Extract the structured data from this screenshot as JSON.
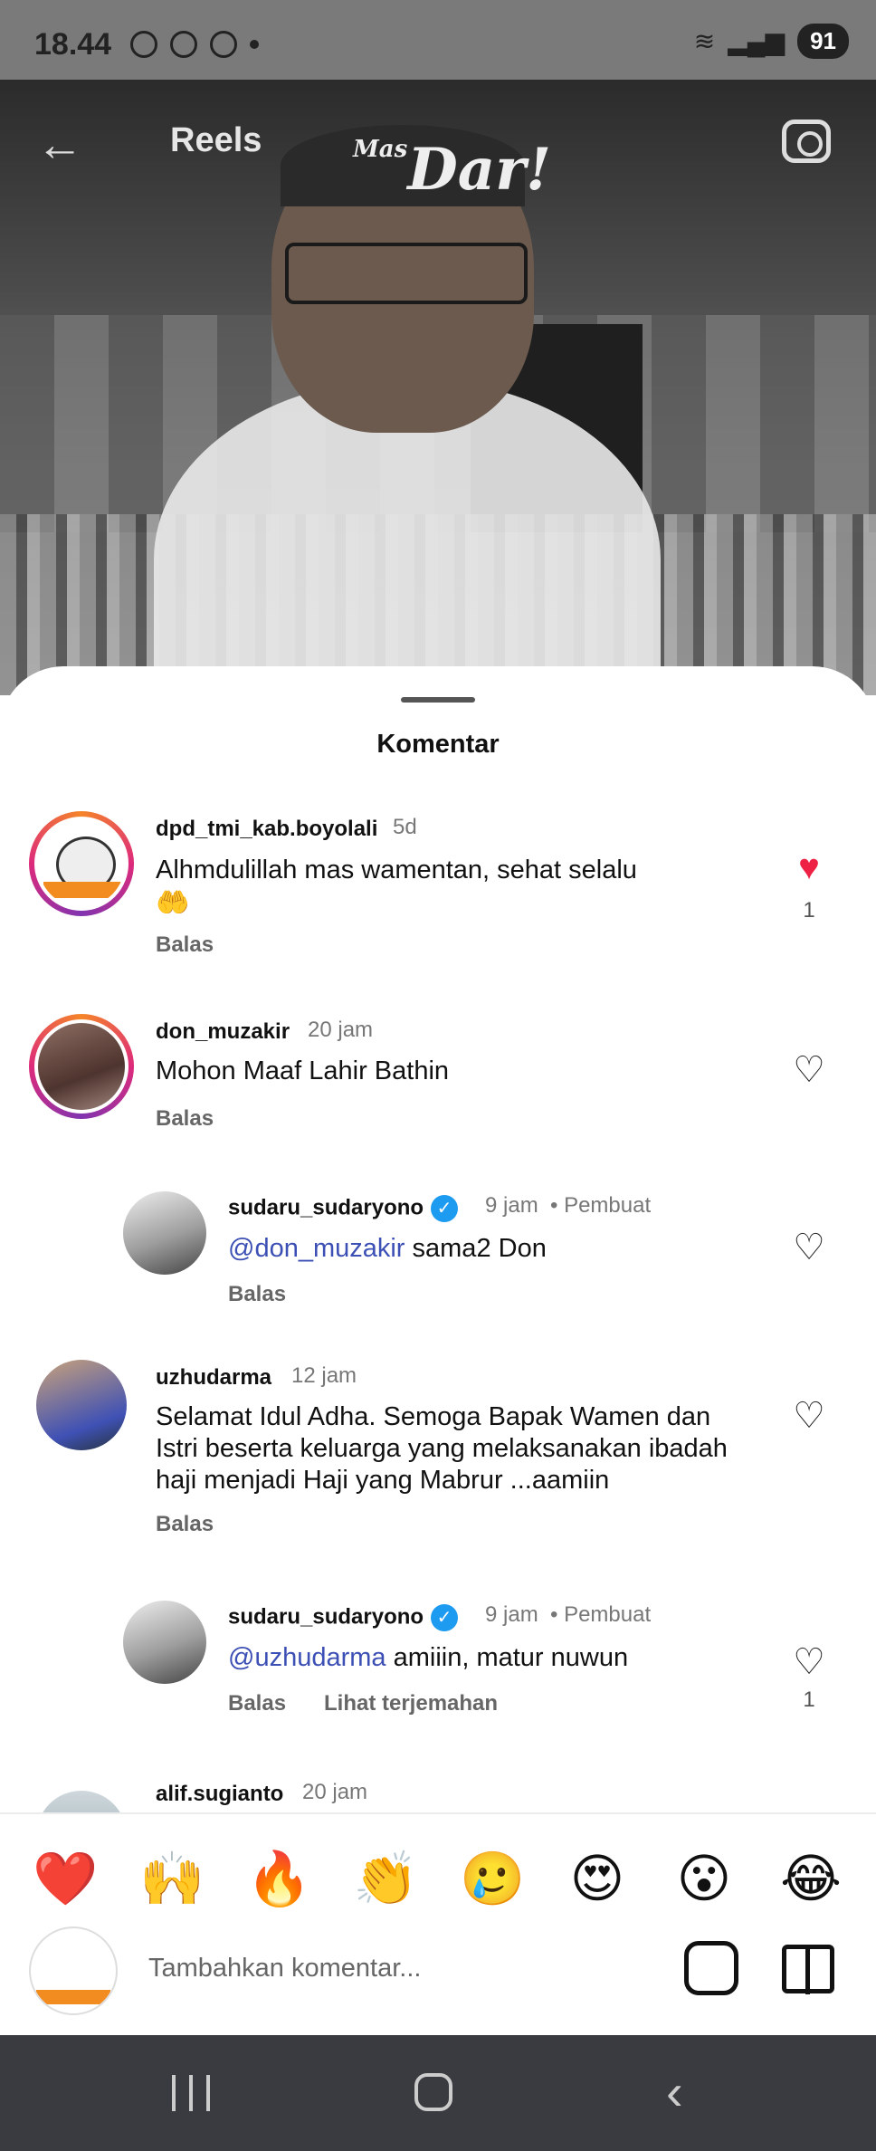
{
  "status": {
    "time": "18.44",
    "battery": "91"
  },
  "reel": {
    "title": "Reels",
    "brand_small": "Mas",
    "brand": "Dar!"
  },
  "sheet": {
    "title": "Komentar"
  },
  "comments": [
    {
      "username": "dpd_tmi_kab.boyolali",
      "time": "5d",
      "text": "Alhmdulillah mas wamentan, sehat selalu",
      "emoji": "🤲",
      "reply": "Balas",
      "likes": "1",
      "liked": true
    },
    {
      "username": "don_muzakir",
      "time": "20 jam",
      "text": "Mohon Maaf Lahir Bathin",
      "reply": "Balas",
      "liked": false
    },
    {
      "username": "sudaru_sudaryono",
      "time": "9 jam",
      "creator": "Pembuat",
      "mention": "@don_muzakir",
      "text": " sama2 Don",
      "reply": "Balas",
      "liked": false
    },
    {
      "username": "uzhudarma",
      "time": "12 jam",
      "text": "Selamat Idul Adha. Semoga Bapak Wamen dan Istri beserta keluarga yang melaksanakan ibadah haji menjadi Haji yang Mabrur ...aamiin",
      "reply": "Balas",
      "liked": false
    },
    {
      "username": "sudaru_sudaryono",
      "time": "9 jam",
      "creator": "Pembuat",
      "mention": "@uzhudarma",
      "text": " amiiin, matur nuwun",
      "reply": "Balas",
      "translate": "Lihat terjemahan",
      "likes": "1",
      "liked": false
    },
    {
      "username": "alif.sugianto",
      "time": "20 jam"
    }
  ],
  "emojis": [
    "❤️",
    "🙌",
    "🔥",
    "👏",
    "🥲",
    "😍",
    "😮",
    "😂"
  ],
  "composer": {
    "placeholder": "Tambahkan komentar..."
  },
  "icons": {
    "back": "arrow-left-icon",
    "camera": "camera-icon",
    "heart": "heart-icon",
    "verified": "verified-badge-icon",
    "sticker": "sticker-icon",
    "gift": "gift-icon"
  },
  "colors": {
    "like": "#ee2244",
    "mention": "#3c4fb5",
    "verified": "#1d9bf0"
  }
}
